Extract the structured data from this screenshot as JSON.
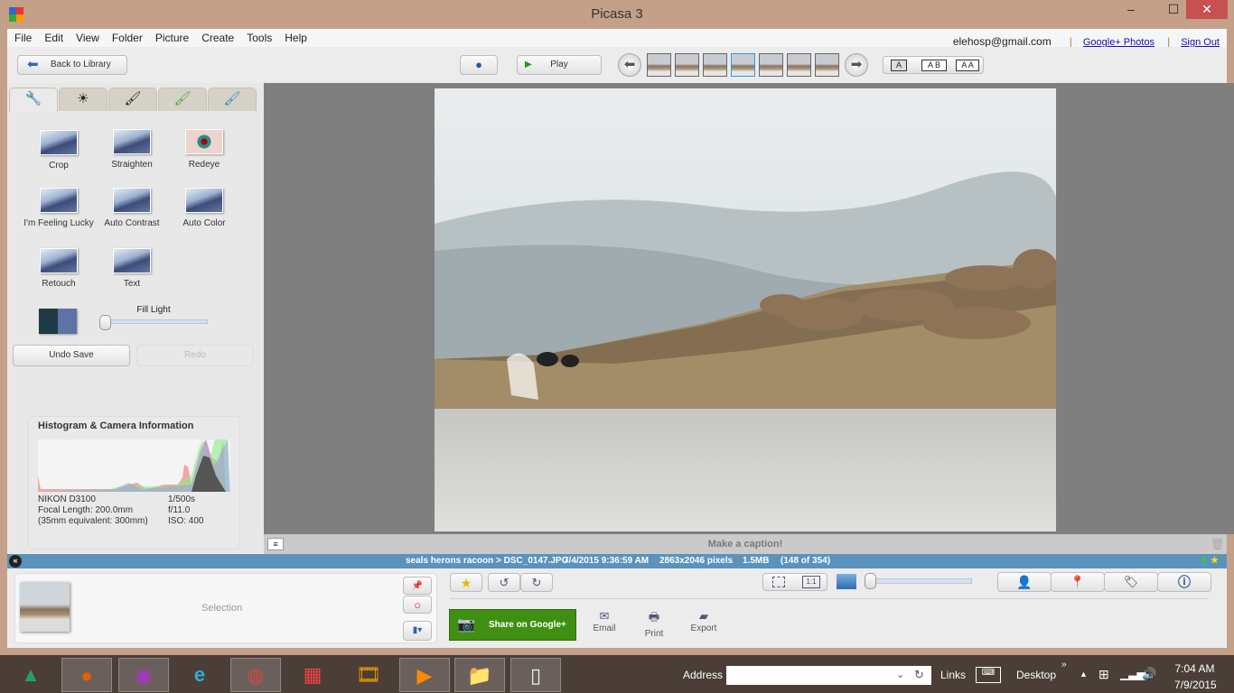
{
  "window": {
    "title": "Picasa 3",
    "min": "–",
    "max": "☐",
    "close": "✕"
  },
  "menu": [
    "File",
    "Edit",
    "View",
    "Folder",
    "Picture",
    "Create",
    "Tools",
    "Help"
  ],
  "account": {
    "email": "elehosp@gmail.com",
    "google_photos": "Google+ Photos",
    "sign_out": "Sign Out"
  },
  "toolbar": {
    "back": "Back to Library",
    "play": "Play",
    "layouts": [
      "A",
      "A B",
      "A A"
    ]
  },
  "tabs": [
    {
      "icon": "wrench-icon",
      "glyph": "🔧"
    },
    {
      "icon": "brightness-icon",
      "glyph": "☀"
    },
    {
      "icon": "brush-icon",
      "glyph": "🖌"
    },
    {
      "icon": "brush-green-icon",
      "glyph": "🖌"
    },
    {
      "icon": "brush-blue-icon",
      "glyph": "🖌"
    }
  ],
  "tools": [
    "Crop",
    "Straighten",
    "Redeye",
    "I'm Feeling Lucky",
    "Auto Contrast",
    "Auto Color",
    "Retouch",
    "Text"
  ],
  "fill_light": {
    "label": "Fill Light",
    "value": 0
  },
  "undo": "Undo Save",
  "redo": "Redo",
  "histogram": {
    "title": "Histogram & Camera Information",
    "camera": "NIKON D3100",
    "focal": "Focal Length: 200.0mm",
    "equiv": "(35mm equivalent: 300mm)",
    "shutter": "1/500s",
    "aperture": "f/11.0",
    "iso": "ISO: 400"
  },
  "caption_placeholder": "Make a caption!",
  "status": {
    "path": "seals herons racoon > DSC_0147.JPG",
    "date": "7/4/2015 9:36:59 AM",
    "dims": "2863x2046 pixels",
    "size": "1.5MB",
    "count": "(148 of 354)"
  },
  "selection": {
    "label": "Selection"
  },
  "actions": {
    "share": "Share on Google+",
    "email": "Email",
    "print": "Print",
    "export": "Export",
    "one_to_one": "1:1"
  },
  "taskbar": {
    "address_label": "Address",
    "address_value": "",
    "links": "Links",
    "desktop": "Desktop",
    "time": "7:04 AM",
    "date": "7/9/2015"
  },
  "colors": {
    "status_bar": "#5b93bc",
    "share_button": "#3f8f12",
    "title_bar": "#c4a088"
  }
}
